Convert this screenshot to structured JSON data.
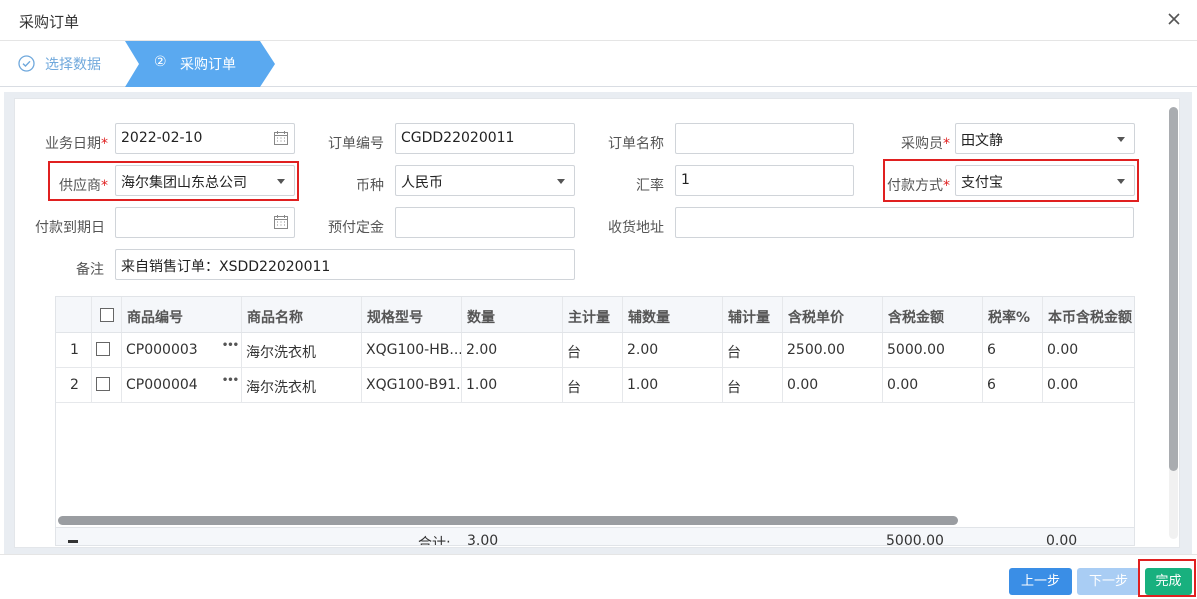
{
  "dialog": {
    "title": "采购订单"
  },
  "steps": [
    {
      "label": "选择数据"
    },
    {
      "number": "②",
      "label": "采购订单"
    }
  ],
  "form": {
    "business_date": {
      "label": "业务日期",
      "required": "*",
      "value": "2022-02-10"
    },
    "order_no": {
      "label": "订单编号",
      "value": "CGDD22020011"
    },
    "order_name": {
      "label": "订单名称",
      "value": ""
    },
    "buyer": {
      "label": "采购员",
      "required": "*",
      "value": "田文静"
    },
    "supplier": {
      "label": "供应商",
      "required": "*",
      "value": "海尔集团山东总公司"
    },
    "currency": {
      "label": "币种",
      "value": "人民币"
    },
    "exchange_rate": {
      "label": "汇率",
      "value": "1"
    },
    "payment_method": {
      "label": "付款方式",
      "required": "*",
      "value": "支付宝"
    },
    "payment_due": {
      "label": "付款到期日",
      "value": ""
    },
    "deposit": {
      "label": "预付定金",
      "value": ""
    },
    "address": {
      "label": "收货地址",
      "value": ""
    },
    "remark": {
      "label": "备注",
      "value": "来自销售订单：XSDD22020011"
    }
  },
  "table": {
    "columns": [
      "商品编号",
      "商品名称",
      "规格型号",
      "数量",
      "主计量",
      "辅数量",
      "辅计量",
      "含税单价",
      "含税金额",
      "税率%",
      "本币含税金额"
    ],
    "rows": [
      {
        "idx": "1",
        "code": "CP000003",
        "name": "海尔洗衣机",
        "spec": "XQG100-HB...",
        "qty": "2.00",
        "unit": "台",
        "aux_qty": "2.00",
        "aux_unit": "台",
        "price": "2500.00",
        "amount": "5000.00",
        "tax": "6",
        "local_amount": "0.00"
      },
      {
        "idx": "2",
        "code": "CP000004",
        "name": "海尔洗衣机",
        "spec": "XQG100-B91...",
        "qty": "1.00",
        "unit": "台",
        "aux_qty": "1.00",
        "aux_unit": "台",
        "price": "0.00",
        "amount": "0.00",
        "tax": "6",
        "local_amount": "0.00"
      }
    ],
    "footer": {
      "label": "合计:",
      "qty": "3.00",
      "amount": "5000.00",
      "local_amount": "0.00"
    }
  },
  "buttons": {
    "prev": "上一步",
    "next": "下一步",
    "done": "完成"
  },
  "colors": {
    "accent": "#3a8ee6",
    "step_active": "#5aa9f0",
    "done": "#18b07e",
    "highlight": "#e02020"
  }
}
